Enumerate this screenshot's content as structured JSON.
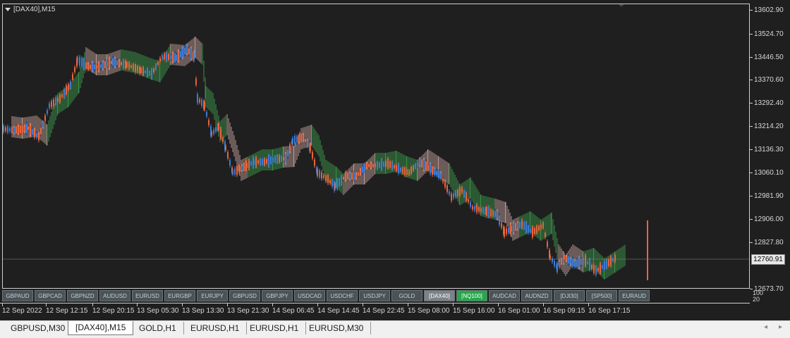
{
  "chart": {
    "title": "[DAX40],M15",
    "current_price": "12760.91",
    "price_labels": [
      "13602.90",
      "13524.70",
      "13446.50",
      "13370.60",
      "13292.40",
      "13214.20",
      "13136.30",
      "13060.10",
      "12981.90",
      "12906.00",
      "12827.80",
      "12760.91",
      "12673.70"
    ],
    "indicator_scale": {
      "top": "100",
      "bottom": "20"
    },
    "time_labels": [
      "12 Sep 2022",
      "12 Sep 12:15",
      "12 Sep 20:15",
      "13 Sep 05:30",
      "13 Sep 13:30",
      "13 Sep 21:30",
      "14 Sep 06:45",
      "14 Sep 14:45",
      "14 Sep 22:45",
      "15 Sep 08:00",
      "15 Sep 16:00",
      "16 Sep 01:00",
      "16 Sep 09:15",
      "16 Sep 17:15"
    ],
    "colors": {
      "background": "#1f1f1f",
      "bull_candle": "#3b7bd6",
      "bear_candle": "#e8643a",
      "cloud_bull": "#3ea650",
      "cloud_bear": "#d6aea8",
      "grid_line": "#8a8a8a"
    }
  },
  "symbols": [
    {
      "label": "GBPAUD",
      "state": "normal"
    },
    {
      "label": "GBPCAD",
      "state": "normal"
    },
    {
      "label": "GBPNZD",
      "state": "normal"
    },
    {
      "label": "AUDUSD",
      "state": "normal"
    },
    {
      "label": "EURUSD",
      "state": "normal"
    },
    {
      "label": "EURGBP",
      "state": "normal"
    },
    {
      "label": "EURJPY",
      "state": "normal"
    },
    {
      "label": "GBPUSD",
      "state": "normal"
    },
    {
      "label": "GBPJPY",
      "state": "normal"
    },
    {
      "label": "USDCAD",
      "state": "normal"
    },
    {
      "label": "USDCHF",
      "state": "normal"
    },
    {
      "label": "USDJPY",
      "state": "normal"
    },
    {
      "label": "GOLD",
      "state": "normal"
    },
    {
      "label": "[DAX40]",
      "state": "active-gray"
    },
    {
      "label": "[NQ100]",
      "state": "active-green"
    },
    {
      "label": "AUDCAD",
      "state": "normal"
    },
    {
      "label": "AUDNZD",
      "state": "normal"
    },
    {
      "label": "[DJI30]",
      "state": "normal"
    },
    {
      "label": "[SP500]",
      "state": "normal"
    },
    {
      "label": "EURAUD",
      "state": "normal"
    }
  ],
  "tabs": [
    "GBPUSD,M30",
    "[DAX40],M15",
    "GOLD,H1",
    "EURUSD,H1",
    "EURUSD,H1",
    "EURUSD,M30"
  ],
  "active_tab": 1,
  "nav": {
    "left": "◂",
    "right": "▸"
  }
}
